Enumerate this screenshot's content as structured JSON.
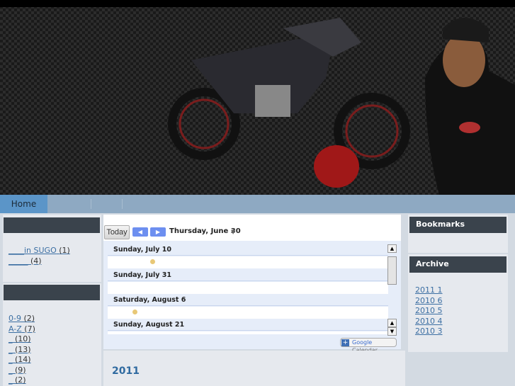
{
  "nav": {
    "items": [
      {
        "label": "Home"
      }
    ]
  },
  "left": {
    "box1": {
      "links": [
        {
          "label": "____in SUGO",
          "count": "(1)"
        },
        {
          "label": "_____",
          "count": "(4)"
        }
      ]
    },
    "box2": {
      "links": [
        {
          "label": "0-9",
          "count": "(2)"
        },
        {
          "label": "A-Z",
          "count": "(7)"
        },
        {
          "label": "_",
          "count": "(10)"
        },
        {
          "label": "_",
          "count": "(13)"
        },
        {
          "label": "_",
          "count": "(14)"
        },
        {
          "label": "_",
          "count": "(9)"
        },
        {
          "label": "_",
          "count": "(2)"
        }
      ]
    }
  },
  "calendar": {
    "today": "Today",
    "prev": "◀",
    "next": "▶",
    "date": "Thursday, June 30",
    "dropdown": "▼",
    "days": [
      "Sunday, July 10",
      "Sunday, July 31",
      "Saturday, August 6",
      "Sunday, August 21"
    ],
    "badge_plus": "+",
    "badge_google": "Google",
    "badge_calendar": "Calendar",
    "scroll_up": "▲",
    "scroll_down": "▼"
  },
  "post": {
    "title": "2011"
  },
  "right": {
    "bookmarks": "Bookmarks",
    "archive": "Archive",
    "archive_links": [
      "2011 1 ",
      "2010 6 ",
      "2010 5 ",
      "2010 4 ",
      "2010 3 "
    ]
  }
}
